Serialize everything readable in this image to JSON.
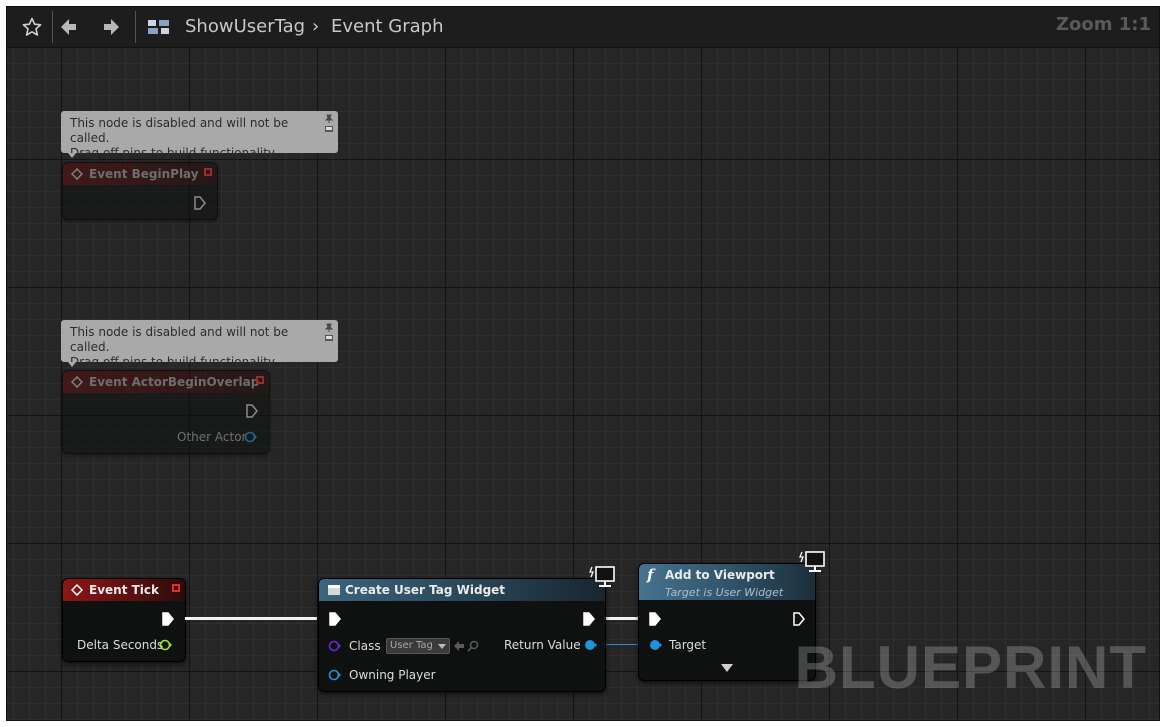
{
  "breadcrumb": {
    "blueprint": "ShowUserTag",
    "graph": "Event Graph"
  },
  "zoom": "Zoom 1:1",
  "comments": {
    "disabled_line1": "This node is disabled and will not be called.",
    "disabled_line2": "Drag off pins to build functionality."
  },
  "nodes": {
    "begin_play": {
      "title": "Event BeginPlay"
    },
    "actor_overlap": {
      "title": "Event ActorBeginOverlap",
      "pin_other_actor": "Other Actor"
    },
    "event_tick": {
      "title": "Event Tick",
      "pin_delta": "Delta Seconds"
    },
    "create_widget": {
      "title": "Create User Tag Widget",
      "pin_class": "Class",
      "class_value": "User Tag",
      "pin_owning_player": "Owning Player",
      "pin_return": "Return Value"
    },
    "add_to_viewport": {
      "title": "Add to Viewport",
      "subtitle": "Target is User Widget",
      "pin_target": "Target"
    }
  },
  "watermark": "BLUEPRINT",
  "colors": {
    "exec_wire": "#f2f2f2",
    "object_wire": "#1e93d9",
    "float_pin": "#9be23a",
    "class_pin": "#6d2bd6",
    "event_header": "#8c1616",
    "function_header": "#3b6480"
  }
}
